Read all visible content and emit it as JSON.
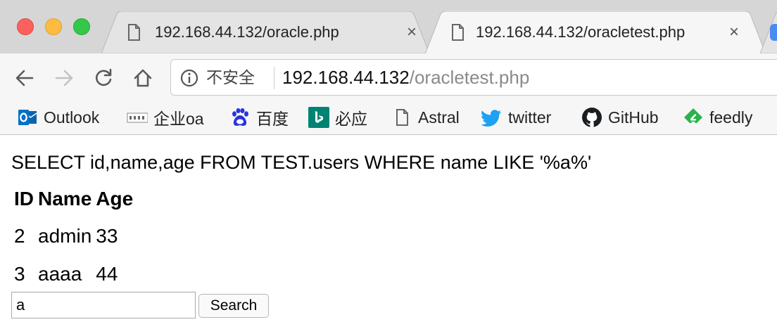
{
  "tabs": [
    {
      "title": "192.168.44.132/oracle.php",
      "close": "×",
      "active": false
    },
    {
      "title": "192.168.44.132/oracletest.php",
      "close": "×",
      "active": true
    }
  ],
  "address_bar": {
    "security_label": "不安全",
    "host": "192.168.44.132",
    "path": "/oracletest.php"
  },
  "bookmarks": [
    {
      "label": "Outlook",
      "icon": "outlook-icon"
    },
    {
      "label": "企业oa",
      "icon": "abys-icon"
    },
    {
      "label": "百度",
      "icon": "baidu-icon"
    },
    {
      "label": "必应",
      "icon": "bing-icon"
    },
    {
      "label": "Astral",
      "icon": "page-icon"
    },
    {
      "label": "twitter",
      "icon": "twitter-icon"
    },
    {
      "label": "GitHub",
      "icon": "github-icon"
    },
    {
      "label": "feedly",
      "icon": "feedly-icon"
    }
  ],
  "page": {
    "query": "SELECT id,name,age FROM TEST.users WHERE name LIKE '%a%'",
    "table": {
      "headers": [
        "ID",
        "Name",
        "Age"
      ],
      "rows": [
        [
          "2",
          "admin",
          "33"
        ],
        [
          "3",
          "aaaa",
          "44"
        ]
      ]
    },
    "search": {
      "value": "a",
      "button_label": "Search"
    }
  },
  "colors": {
    "tabstrip": "#d6d6d6",
    "toolbar": "#f6f6f6",
    "accent_twitter": "#1da1f2",
    "accent_feedly": "#2bb24c",
    "accent_bing": "#008373",
    "accent_outlook": "#0072c6",
    "accent_baidu": "#2932e1"
  }
}
